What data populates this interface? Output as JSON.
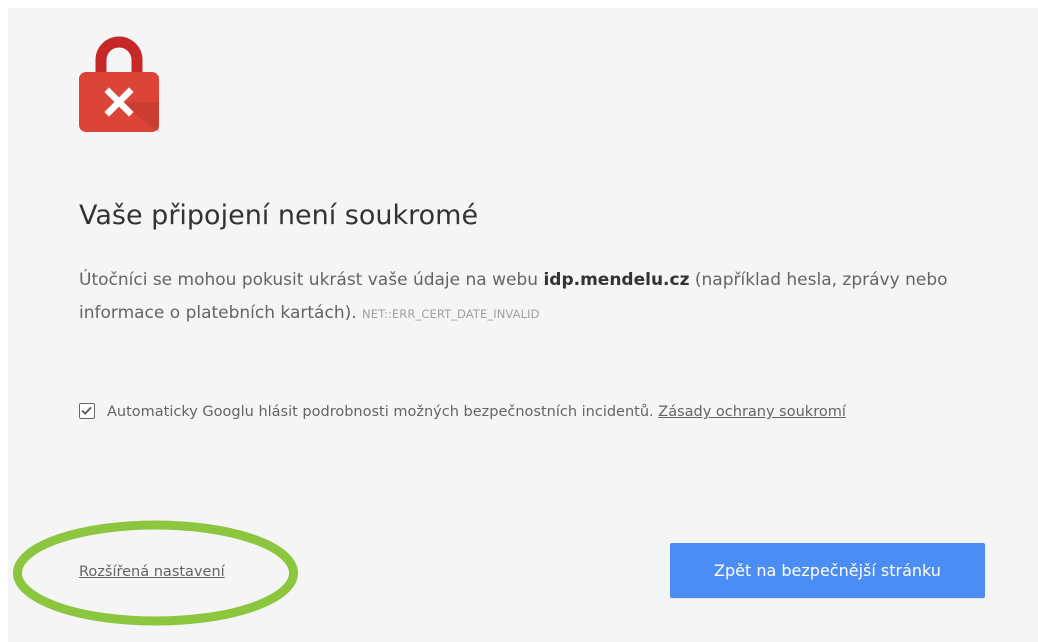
{
  "page": {
    "heading": "Vaše připojení není soukromé",
    "message_before": "Útočníci se mohou pokusit ukrást vaše údaje na webu ",
    "host": "idp.mendelu.cz",
    "message_after": " (například hesla, zprávy nebo informace o platebních kartách). ",
    "error_code": "NET::ERR_CERT_DATE_INVALID"
  },
  "report": {
    "checked": true,
    "label": "Automaticky Googlu hlásit podrobnosti možných bezpečnostních incidentů. ",
    "privacy_link": "Zásady ochrany soukromí"
  },
  "actions": {
    "advanced_label": "Rozšířená nastavení",
    "back_label": "Zpět na bezpečnější stránku"
  },
  "icons": {
    "lock": "lock-error-icon",
    "check": "checkmark-icon"
  },
  "colors": {
    "background": "#f5f5f5",
    "lock_red": "#db4437",
    "button_blue": "#4c8df5",
    "highlight_green": "#8cc63f"
  }
}
